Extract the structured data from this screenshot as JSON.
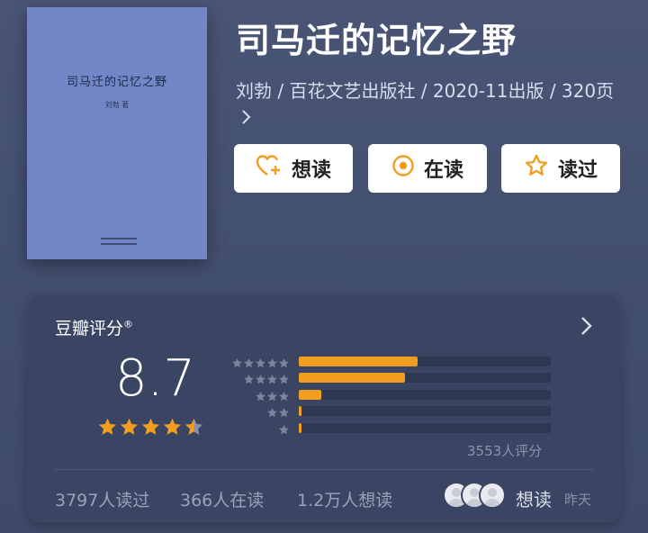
{
  "book": {
    "title": "司马迁的记忆之野",
    "meta": "刘勃 / 百花文艺出版社 / 2020-11出版 / 320页",
    "cover_title": "司马迁的记忆之野",
    "cover_author": "刘勃 著",
    "cover_color": "#7287c7"
  },
  "actions": {
    "want_label": "想读",
    "reading_label": "在读",
    "read_label": "读过",
    "icon_color": "#f19e1f"
  },
  "rating": {
    "label": "豆瓣评分",
    "registered": "®",
    "score": "8.7",
    "stars_filled": 4.5,
    "distribution_fraction": [
      0.47,
      0.42,
      0.09,
      0.01,
      0.01
    ],
    "count_text": "3553人评分",
    "bar_color": "#f19e1f"
  },
  "stats": {
    "read": "3797人读过",
    "reading": "366人在读",
    "want": "1.2万人想读",
    "friends_label": "想读",
    "friends_time": "昨天"
  }
}
